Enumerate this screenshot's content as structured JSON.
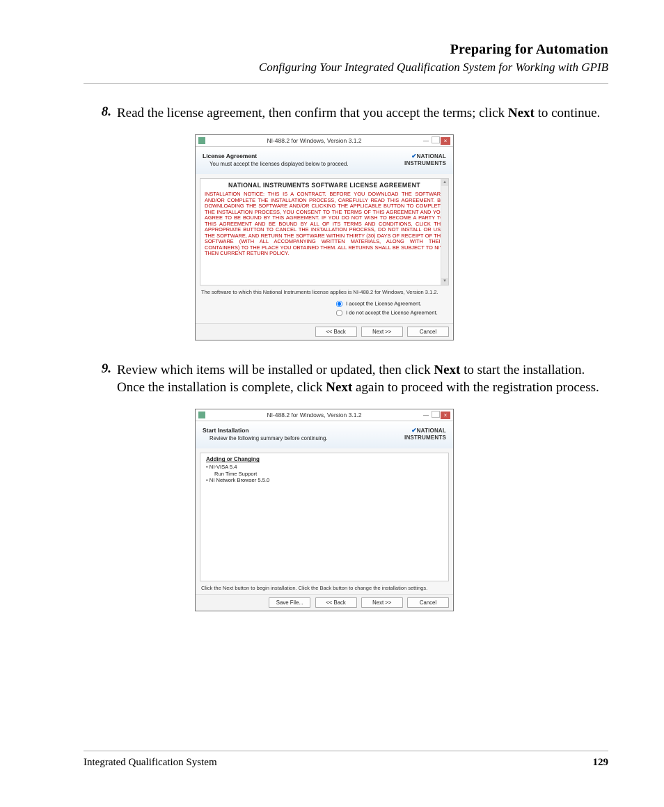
{
  "header": {
    "title": "Preparing for Automation",
    "subtitle": "Configuring Your Integrated Qualification System for Working with GPIB"
  },
  "steps": {
    "s8": {
      "num": "8.",
      "text_a": "Read the license agreement, then confirm that you accept the terms; click ",
      "bold": "Next",
      "text_b": " to continue."
    },
    "s9": {
      "num": "9.",
      "text_a": "Review which items will be installed or updated, then click ",
      "bold1": "Next",
      "text_b": " to start the installation. Once the installation is complete, click ",
      "bold2": "Next",
      "text_c": " again to proceed with the registration process."
    }
  },
  "dialog_common": {
    "window_title": "NI-488.2 for Windows, Version 3.1.2",
    "brand_top": "NATIONAL",
    "brand_bottom": "INSTRUMENTS"
  },
  "dialog1": {
    "banner_title": "License Agreement",
    "banner_sub": "You must accept the licenses displayed below to proceed.",
    "license_heading": "NATIONAL INSTRUMENTS SOFTWARE LICENSE AGREEMENT",
    "license_body": "INSTALLATION NOTICE: THIS IS A CONTRACT. BEFORE YOU DOWNLOAD THE SOFTWARE AND/OR COMPLETE THE INSTALLATION PROCESS, CAREFULLY READ THIS AGREEMENT. BY DOWNLOADING THE SOFTWARE AND/OR CLICKING THE APPLICABLE BUTTON TO COMPLETE THE INSTALLATION PROCESS, YOU CONSENT TO THE TERMS OF THIS AGREEMENT AND YOU AGREE TO BE BOUND BY THIS AGREEMENT. IF YOU DO NOT WISH TO BECOME A PARTY TO THIS AGREEMENT AND BE BOUND BY ALL OF ITS TERMS AND CONDITIONS, CLICK THE APPROPRIATE BUTTON TO CANCEL THE INSTALLATION PROCESS, DO NOT INSTALL OR USE THE SOFTWARE, AND RETURN THE SOFTWARE WITHIN THIRTY (30) DAYS OF RECEIPT OF THE SOFTWARE (WITH ALL ACCOMPANYING WRITTEN MATERIALS, ALONG WITH THEIR CONTAINERS) TO THE PLACE YOU OBTAINED THEM. ALL RETURNS SHALL BE SUBJECT TO NI'S THEN CURRENT RETURN POLICY.",
    "note": "The software to which this National Instruments license applies is NI-488.2 for Windows, Version 3.1.2.",
    "radio_accept": "I accept the License Agreement.",
    "radio_decline": "I do not accept the License Agreement.",
    "btn_back": "<< Back",
    "btn_next": "Next >>",
    "btn_cancel": "Cancel"
  },
  "dialog2": {
    "banner_title": "Start Installation",
    "banner_sub": "Review the following summary before continuing.",
    "heading": "Adding or Changing",
    "item1": "• NI-VISA 5.4",
    "item1a": "Run Time Support",
    "item2": "• NI Network Browser 5.5.0",
    "note": "Click the Next button to begin installation.  Click the Back button to change the installation settings.",
    "btn_save": "Save File...",
    "btn_back": "<< Back",
    "btn_next": "Next >>",
    "btn_cancel": "Cancel"
  },
  "footer": {
    "left": "Integrated Qualification System",
    "page": "129"
  }
}
